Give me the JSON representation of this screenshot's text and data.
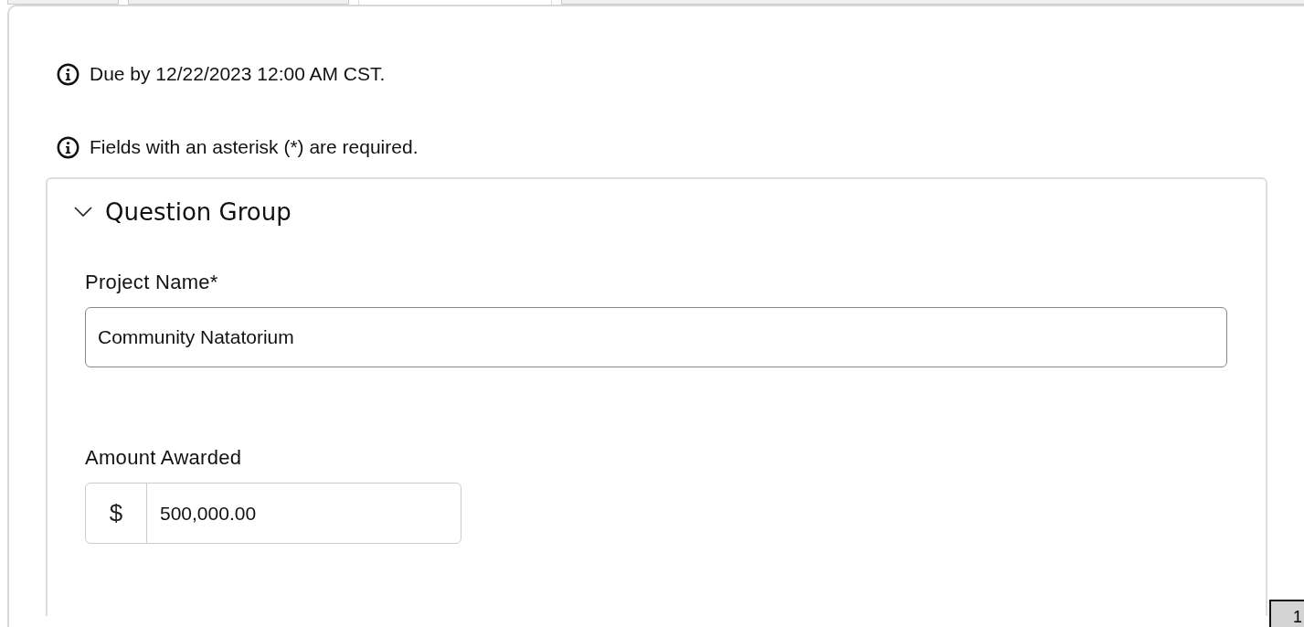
{
  "tabs": [
    {
      "selected": false
    },
    {
      "selected": false
    },
    {
      "selected": true
    },
    {
      "selected": false
    }
  ],
  "notices": [
    "Due by 12/22/2023 12:00 AM CST.",
    "Fields with an asterisk (*) are required."
  ],
  "question_group": {
    "title": "Question Group",
    "expanded": true,
    "fields": [
      {
        "kind": "text",
        "label": "Project Name*",
        "value": "Community Natatorium"
      },
      {
        "kind": "currency",
        "label": "Amount Awarded",
        "prefix": "$",
        "value": "500,000.00"
      }
    ]
  },
  "page_button": {
    "label": "1"
  }
}
